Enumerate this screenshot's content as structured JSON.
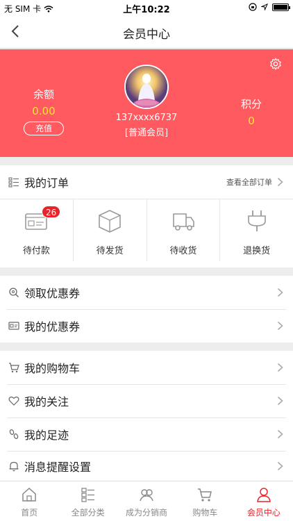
{
  "status_bar": {
    "carrier": "无 SIM 卡",
    "time": "上午10:22",
    "battery_level": 1.0
  },
  "navbar": {
    "title": "会员中心"
  },
  "hero": {
    "balance_label": "余额",
    "balance_value": "0.00",
    "recharge_label": "充值",
    "phone": "137xxxx6737",
    "level": "[普通会员]",
    "points_label": "积分",
    "points_value": "0"
  },
  "orders": {
    "title": "我的订单",
    "view_all": "查看全部订单",
    "items": [
      {
        "label": "待付款",
        "icon": "pending-payment-icon",
        "badge": "26"
      },
      {
        "label": "待发货",
        "icon": "box-icon"
      },
      {
        "label": "待收货",
        "icon": "truck-icon"
      },
      {
        "label": "退换货",
        "icon": "plug-icon"
      }
    ]
  },
  "coupons": {
    "get": "领取优惠券",
    "mine": "我的优惠券"
  },
  "menu": {
    "cart": "我的购物车",
    "follow": "我的关注",
    "history": "我的足迹",
    "notify": "消息提醒设置"
  },
  "tabbar": {
    "items": [
      {
        "label": "首页",
        "icon": "home-icon"
      },
      {
        "label": "全部分类",
        "icon": "category-icon"
      },
      {
        "label": "成为分销商",
        "icon": "distributor-icon"
      },
      {
        "label": "购物车",
        "icon": "cart-icon"
      },
      {
        "label": "会员中心",
        "icon": "user-icon"
      }
    ],
    "active_index": 4
  },
  "colors": {
    "brand": "#ff5a60",
    "accent_yellow": "#ffe23a",
    "badge": "#e8232b"
  }
}
